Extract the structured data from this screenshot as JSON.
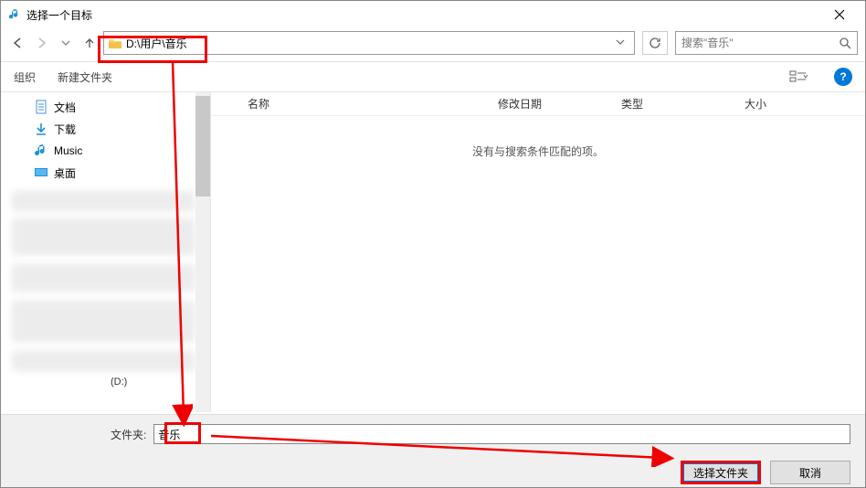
{
  "title": "选择一个目标",
  "address_path": "D:\\用户\\音乐",
  "search_placeholder": "搜索\"音乐\"",
  "toolbar": {
    "organize": "组织",
    "new_folder": "新建文件夹"
  },
  "sidebar": {
    "items": [
      {
        "label": "文档",
        "icon": "doc"
      },
      {
        "label": "下载",
        "icon": "download"
      },
      {
        "label": "Music",
        "icon": "music"
      },
      {
        "label": "桌面",
        "icon": "desktop"
      }
    ],
    "drive_label": "(D:)"
  },
  "columns": {
    "name": "名称",
    "date": "修改日期",
    "type": "类型",
    "size": "大小"
  },
  "empty_message": "没有与搜索条件匹配的项。",
  "folder_label": "文件夹:",
  "folder_value": "音乐",
  "buttons": {
    "select": "选择文件夹",
    "cancel": "取消"
  }
}
